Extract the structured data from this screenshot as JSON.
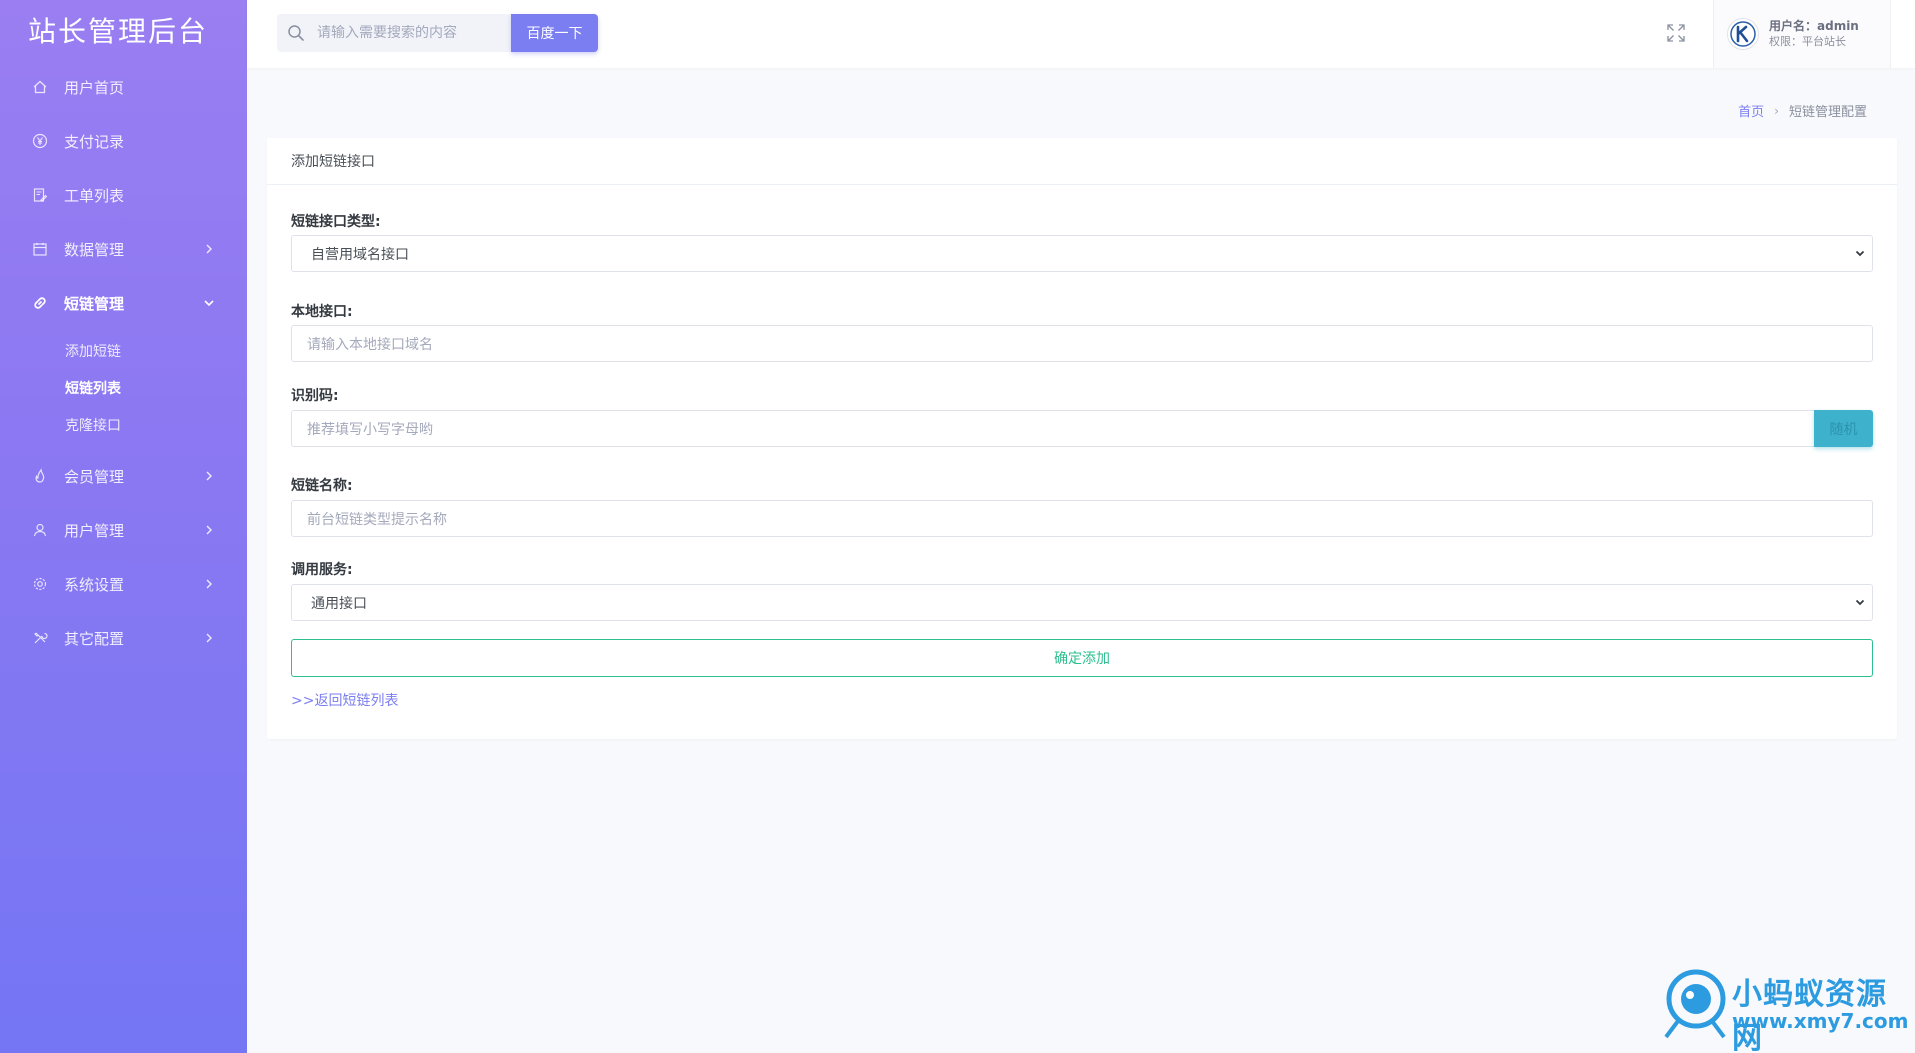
{
  "brand": "站长管理后台",
  "sidebar": {
    "items": [
      {
        "label": "用户首页",
        "icon": "home-icon"
      },
      {
        "label": "支付记录",
        "icon": "yen-icon"
      },
      {
        "label": "工单列表",
        "icon": "edit-doc-icon"
      },
      {
        "label": "数据管理",
        "icon": "calendar-icon"
      },
      {
        "label": "短链管理",
        "icon": "link-icon"
      },
      {
        "label": "会员管理",
        "icon": "fire-icon"
      },
      {
        "label": "用户管理",
        "icon": "user-icon"
      },
      {
        "label": "系统设置",
        "icon": "gear-icon"
      },
      {
        "label": "其它配置",
        "icon": "tools-icon"
      }
    ],
    "submenu": [
      "添加短链",
      "短链列表",
      "克隆接口"
    ]
  },
  "topbar": {
    "search_placeholder": "请输入需要搜索的内容",
    "search_button": "百度一下",
    "user_name_label": "用户名：admin",
    "user_role_label": "权限：平台站长"
  },
  "breadcrumb": {
    "home": "首页",
    "separator": "›",
    "current": "短链管理配置"
  },
  "card": {
    "title": "添加短链接口",
    "type_label": "短链接口类型:",
    "type_value": "自营用域名接口",
    "local_label": "本地接口:",
    "local_placeholder": "请输入本地接口域名",
    "code_label": "识别码:",
    "code_placeholder": "推荐填写小写字母哟",
    "random_button": "随机",
    "name_label": "短链名称:",
    "name_placeholder": "前台短链类型提示名称",
    "service_label": "调用服务:",
    "service_value": "通用接口",
    "submit_button": "确定添加",
    "back_link": ">>返回短链列表"
  },
  "watermark": {
    "line1": "小蚂蚁资源网",
    "line2": "www.xmy7.com"
  },
  "colors": {
    "accent": "#7b7ef0",
    "success": "#2ebf8f",
    "info": "#3eb1cd",
    "sidebar_top": "#9a7ef2",
    "sidebar_bottom": "#7476f4"
  }
}
